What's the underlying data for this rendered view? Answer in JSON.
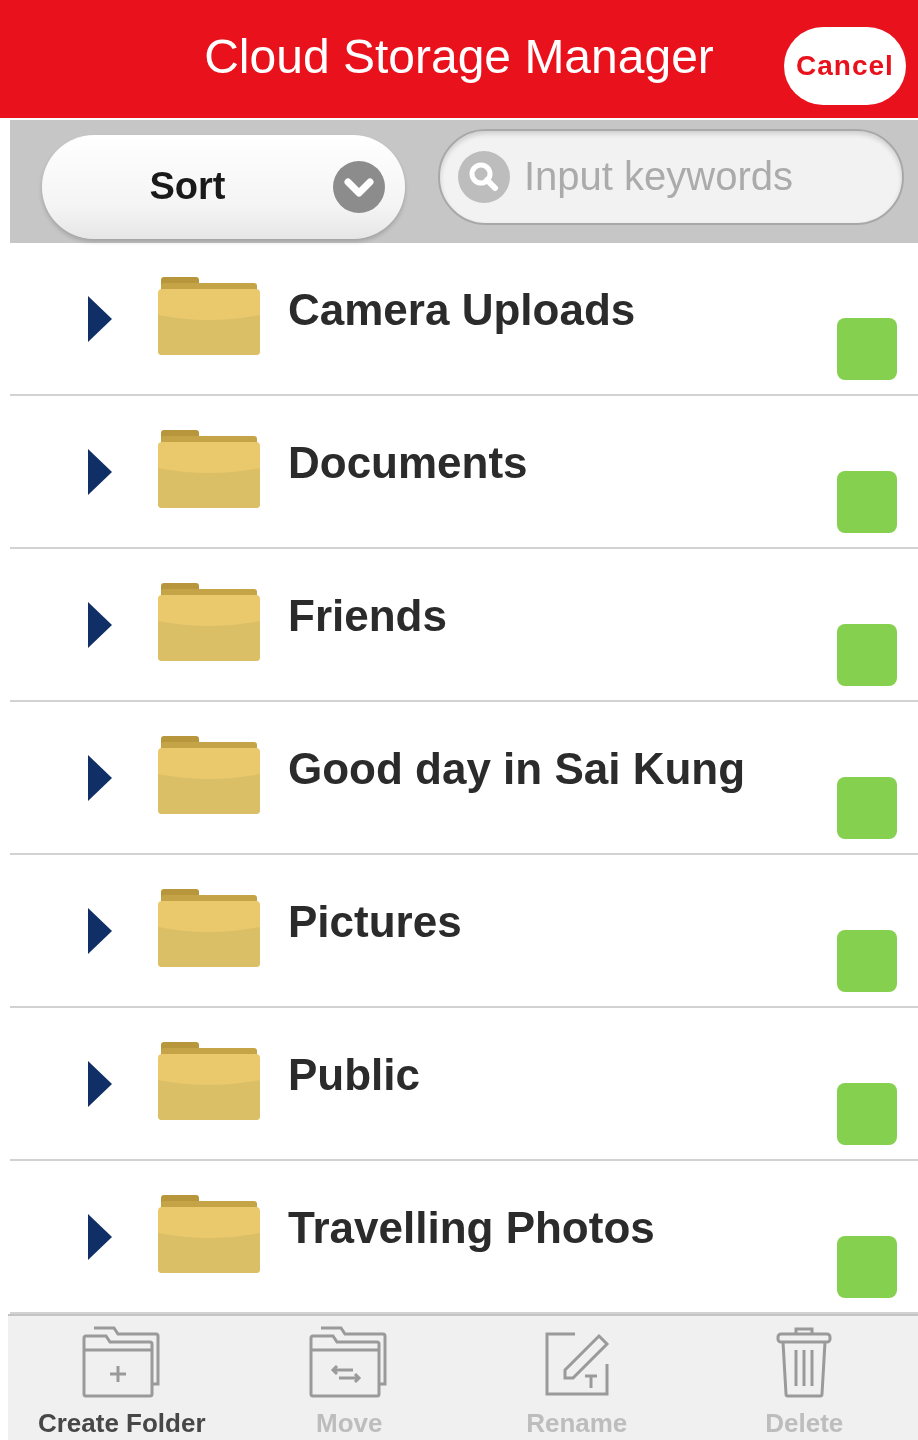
{
  "header": {
    "title": "Cloud Storage Manager",
    "cancel_button": "Cancel"
  },
  "filter_bar": {
    "sort_button": "Sort",
    "search": {
      "placeholder": "Input keywords"
    }
  },
  "folders": [
    {
      "name": "Camera Uploads",
      "expanded": false
    },
    {
      "name": "Documents",
      "expanded": false
    },
    {
      "name": "Friends",
      "expanded": false
    },
    {
      "name": "Good day in Sai Kung",
      "expanded": false
    },
    {
      "name": "Pictures",
      "expanded": false
    },
    {
      "name": "Public",
      "expanded": false
    },
    {
      "name": "Travelling Photos",
      "expanded": false
    }
  ],
  "actions": [
    {
      "kind": "create-folder",
      "label": "Create Folder",
      "disabled": false
    },
    {
      "kind": "move",
      "label": "Move",
      "disabled": true
    },
    {
      "kind": "rename",
      "label": "Rename",
      "disabled": true
    },
    {
      "kind": "delete",
      "label": "Delete",
      "disabled": true
    }
  ]
}
